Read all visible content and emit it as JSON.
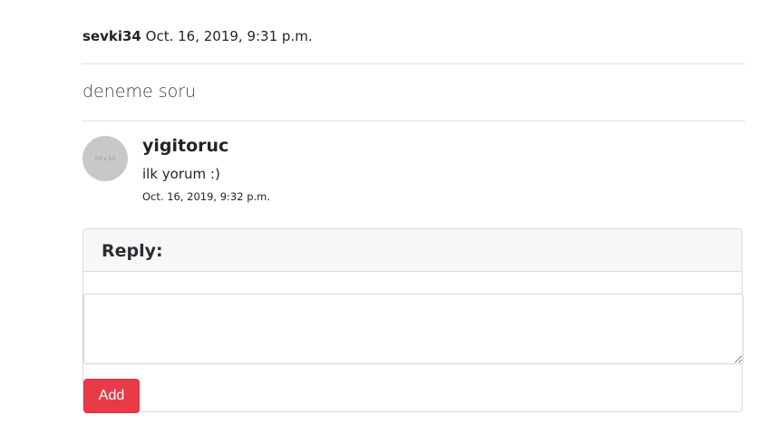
{
  "post": {
    "author": "sevki34",
    "date": "Oct. 16, 2019, 9:31 p.m.",
    "body": "deneme soru"
  },
  "comment": {
    "avatar_placeholder": "50 x 50",
    "author": "yigitoruc",
    "text": "ilk yorum :)",
    "date": "Oct. 16, 2019, 9:32 p.m."
  },
  "reply_form": {
    "title": "Reply:",
    "textarea_value": "",
    "submit_label": "Add"
  },
  "colors": {
    "accent_button": "#e83a47",
    "card_header_bg": "#f7f7f8",
    "avatar_bg": "#c8c8c8"
  }
}
